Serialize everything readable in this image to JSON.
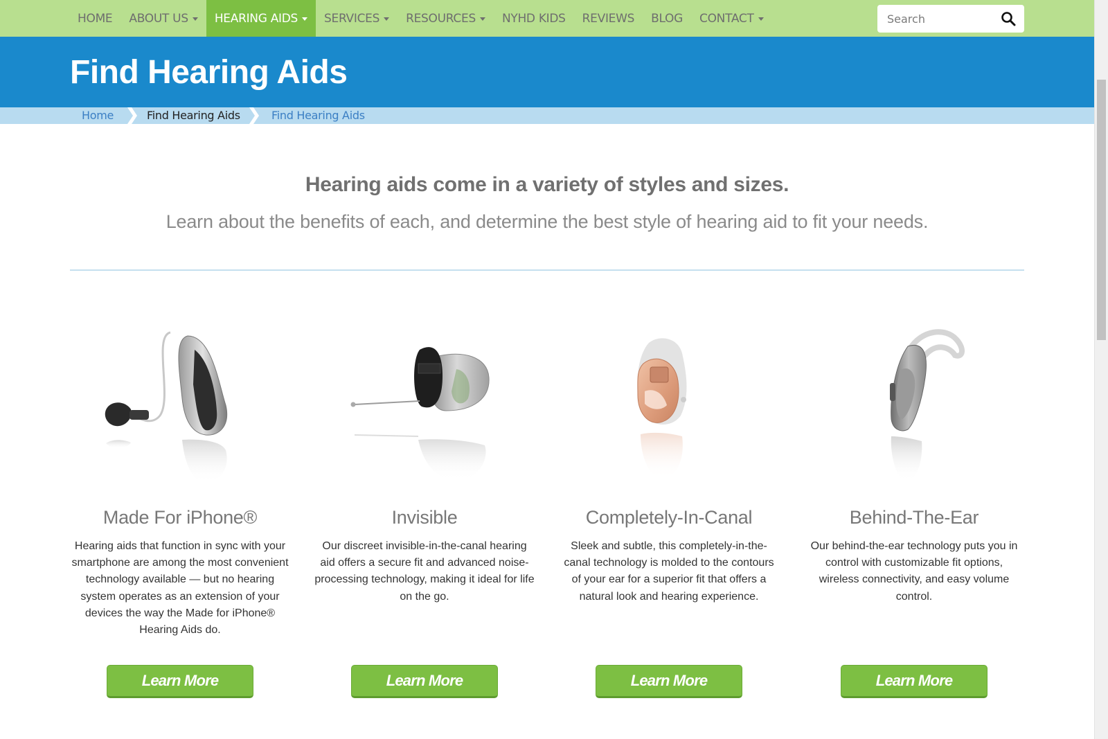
{
  "nav": {
    "items": [
      {
        "label": "HOME",
        "dropdown": false,
        "active": false
      },
      {
        "label": "ABOUT US",
        "dropdown": true,
        "active": false
      },
      {
        "label": "HEARING AIDS",
        "dropdown": true,
        "active": true
      },
      {
        "label": "SERVICES",
        "dropdown": true,
        "active": false
      },
      {
        "label": "RESOURCES",
        "dropdown": true,
        "active": false
      },
      {
        "label": "NYHD KIDS",
        "dropdown": false,
        "active": false
      },
      {
        "label": "REVIEWS",
        "dropdown": false,
        "active": false
      },
      {
        "label": "BLOG",
        "dropdown": false,
        "active": false
      },
      {
        "label": "CONTACT",
        "dropdown": true,
        "active": false
      }
    ],
    "search_placeholder": "Search"
  },
  "banner": {
    "title": "Find Hearing Aids"
  },
  "breadcrumb": {
    "home": "Home",
    "section": "Find Hearing Aids",
    "current": "Find Hearing Aids"
  },
  "intro": {
    "headline": "Hearing aids come in a variety of styles and sizes.",
    "subline": "Learn about the benefits of each, and determine the best style of hearing aid to fit your needs."
  },
  "products": [
    {
      "title": "Made For iPhone®",
      "description": "Hearing aids that function in sync with your smartphone are among the most convenient technology available — but no hearing system operates as an extension of your devices the way the Made for iPhone® Hearing Aids do.",
      "button": "Learn More",
      "image_icon": "ric-hearing-aid-icon"
    },
    {
      "title": "Invisible",
      "description": "Our discreet invisible-in-the-canal hearing aid offers a secure fit and advanced noise-processing technology, making it ideal for life on the go.",
      "button": "Learn More",
      "image_icon": "iic-hearing-aid-icon"
    },
    {
      "title": "Completely-In-Canal",
      "description": "Sleek and subtle, this completely-in-the-canal technology is molded to the contours of your ear for a superior fit that offers a natural look and hearing experience.",
      "button": "Learn More",
      "image_icon": "cic-hearing-aid-icon"
    },
    {
      "title": "Behind-The-Ear",
      "description": "Our behind-the-ear technology puts you in control with customizable fit options, wireless connectivity, and easy volume control.",
      "button": "Learn More",
      "image_icon": "bte-hearing-aid-icon"
    }
  ],
  "colors": {
    "nav_bg": "#b8df8f",
    "nav_active": "#7dbf43",
    "banner_bg": "#1a89cc",
    "breadcrumb_bg": "#b8dbf0",
    "button_green": "#7dbf43"
  }
}
